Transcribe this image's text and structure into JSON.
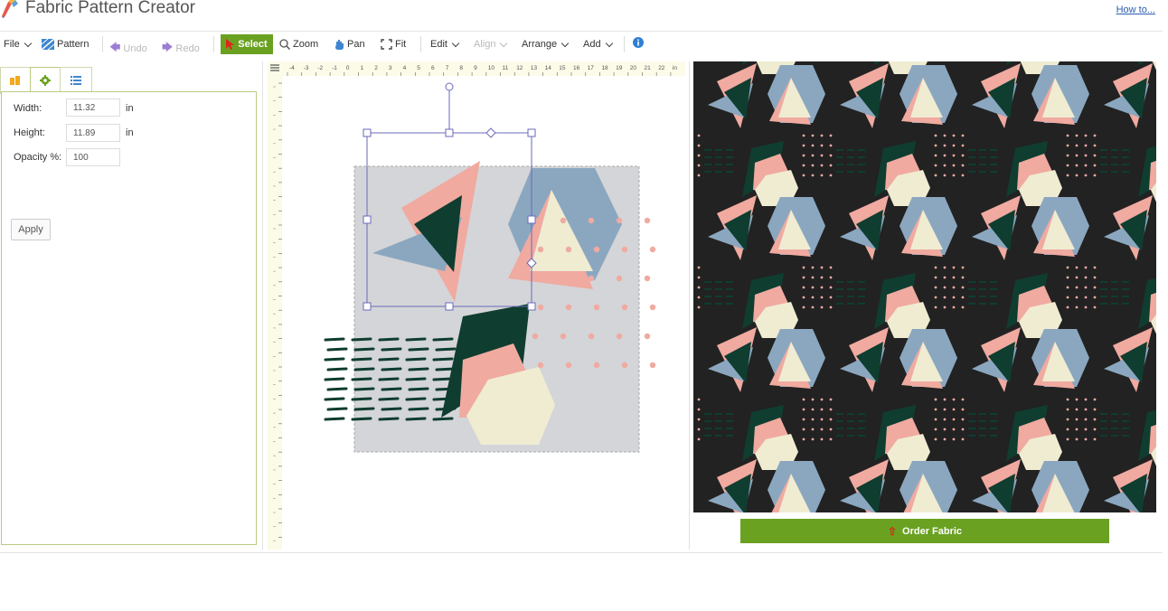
{
  "app": {
    "title": "Fabric Pattern Creator",
    "howto": "How to..."
  },
  "toolbar": {
    "file": "File",
    "pattern": "Pattern",
    "undo": "Undo",
    "redo": "Redo",
    "select": "Select",
    "zoom": "Zoom",
    "pan": "Pan",
    "fit": "Fit",
    "edit": "Edit",
    "align": "Align",
    "arrange": "Arrange",
    "add": "Add"
  },
  "panel": {
    "tabs": [
      {
        "icon": "layers-icon"
      },
      {
        "icon": "gear-icon"
      },
      {
        "icon": "list-icon"
      }
    ],
    "width_label": "Width:",
    "width_value": "11.32",
    "height_label": "Height:",
    "height_value": "11.89",
    "opacity_label": "Opacity %:",
    "opacity_value": "100",
    "unit": "in",
    "apply": "Apply"
  },
  "ruler": {
    "h_labels": [
      "-4",
      "-3",
      "-2",
      "-1",
      "0",
      "1",
      "2",
      "3",
      "4",
      "5",
      "6",
      "7",
      "8",
      "9",
      "10",
      "11",
      "12",
      "13",
      "14",
      "15",
      "16",
      "17",
      "18",
      "19",
      "20",
      "21",
      "22",
      "in"
    ]
  },
  "preview": {
    "order_label": "Order Fabric"
  },
  "colors": {
    "accent": "#6aa121",
    "pink": "#f0aaa0",
    "blue": "#8ba7c0",
    "cream": "#efecd2",
    "dark_green": "#0f3d30",
    "preview_bg": "#222222",
    "canvas_tile": "#d4d5d8",
    "selection": "#6a6ab8"
  }
}
